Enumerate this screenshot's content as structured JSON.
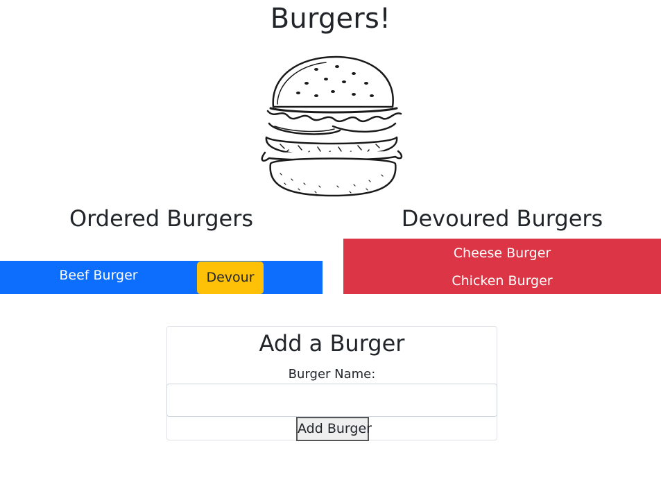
{
  "header": {
    "title": "Burgers!",
    "image_icon": "burger-illustration"
  },
  "ordered": {
    "heading": "Ordered Burgers",
    "items": [
      {
        "name": "Beef Burger",
        "button_label": "Devour"
      }
    ],
    "row_color": "#0d6efd",
    "button_color": "#ffc107"
  },
  "devoured": {
    "heading": "Devoured Burgers",
    "items": [
      {
        "name": "Cheese Burger"
      },
      {
        "name": "Chicken Burger"
      }
    ],
    "row_color": "#dc3545"
  },
  "add_form": {
    "title": "Add a Burger",
    "label": "Burger Name:",
    "input_value": "",
    "input_placeholder": "",
    "button_label": "Add Burger"
  }
}
